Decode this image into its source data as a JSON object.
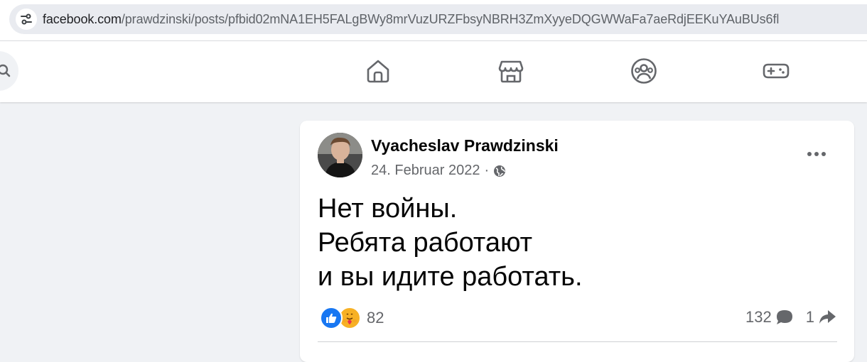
{
  "browser": {
    "url_host": "facebook.com",
    "url_path": "/prawdzinski/posts/pfbid02mNA1EH5FALgBWy8mrVuzURZFbsyNBRH3ZmXyyeDQGWWaFa7aeRdjEEKuYAuBUs6fl",
    "site_settings_icon": "tune-icon"
  },
  "nav": {
    "search_icon": "search-icon",
    "items": [
      {
        "icon": "home-icon"
      },
      {
        "icon": "marketplace-icon"
      },
      {
        "icon": "groups-icon"
      },
      {
        "icon": "gaming-icon"
      }
    ]
  },
  "post": {
    "author": "Vyacheslav Prawdzinski",
    "date": "24. Februar 2022",
    "separator": "·",
    "privacy_icon": "globe-icon",
    "text_lines": [
      "Нет войны.",
      "Ребята работают",
      "и вы идите работать."
    ],
    "reactions": {
      "types": [
        "like-icon",
        "care-icon"
      ],
      "count": "82"
    },
    "comments_count": "132",
    "shares_count": "1"
  },
  "colors": {
    "accent": "#1877f2",
    "secondary_text": "#65676b",
    "background": "#f0f2f5"
  }
}
